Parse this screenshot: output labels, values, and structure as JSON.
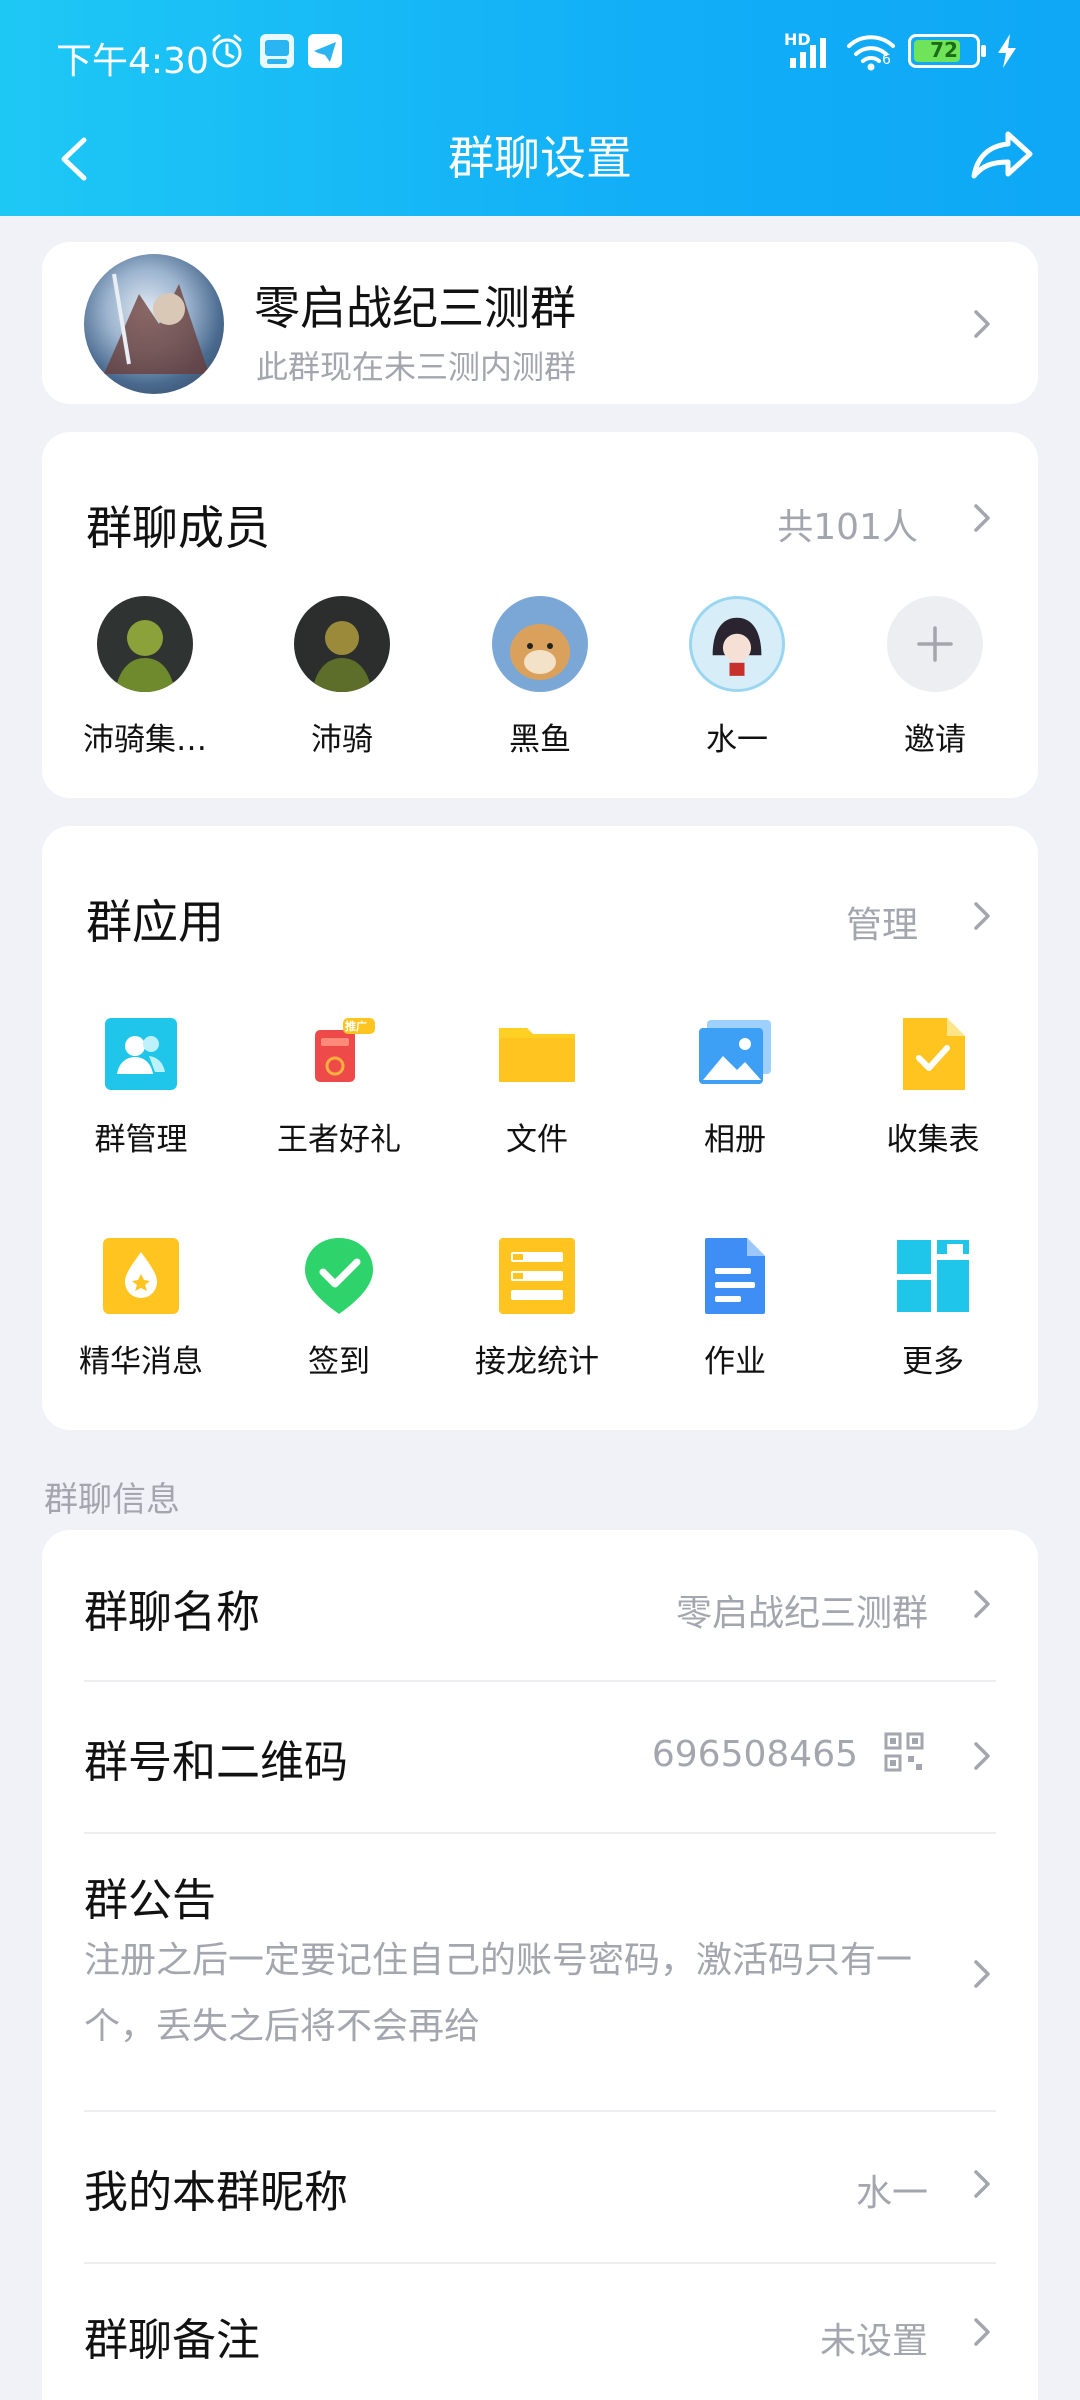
{
  "status_bar": {
    "time": "下午4:30",
    "hd_label": "HD",
    "battery": "72",
    "net_sub": "6"
  },
  "nav": {
    "title": "群聊设置"
  },
  "group": {
    "name": "零启战纪三测群",
    "subtitle": "此群现在未三测内测群"
  },
  "members": {
    "title": "群聊成员",
    "count_label": "共101人",
    "items": [
      {
        "name": "沛骑集…"
      },
      {
        "name": "沛骑"
      },
      {
        "name": "黑鱼"
      },
      {
        "name": "水一"
      },
      {
        "name": "邀请"
      }
    ]
  },
  "apps": {
    "title": "群应用",
    "manage_label": "管理",
    "items": [
      {
        "label": "群管理",
        "icon": "group-manage-icon",
        "color": "#1fc6ea"
      },
      {
        "label": "王者好礼",
        "icon": "gift-icon",
        "color": "#ef4a4a"
      },
      {
        "label": "文件",
        "icon": "folder-icon",
        "color": "#ffc41f"
      },
      {
        "label": "相册",
        "icon": "album-icon",
        "color": "#3ea0f5"
      },
      {
        "label": "收集表",
        "icon": "collect-form-icon",
        "color": "#ffc41f"
      },
      {
        "label": "精华消息",
        "icon": "essence-icon",
        "color": "#ffc41f"
      },
      {
        "label": "签到",
        "icon": "checkin-icon",
        "color": "#2ed36b"
      },
      {
        "label": "接龙统计",
        "icon": "solitaire-icon",
        "color": "#ffc41f"
      },
      {
        "label": "作业",
        "icon": "homework-icon",
        "color": "#3e8ef5"
      },
      {
        "label": "更多",
        "icon": "more-grid-icon",
        "color": "#1fc6ea"
      }
    ],
    "gift_badge": "推广"
  },
  "info": {
    "section_label": "群聊信息",
    "name_label": "群聊名称",
    "name_value": "零启战纪三测群",
    "id_label": "群号和二维码",
    "id_value": "696508465",
    "notice_label": "群公告",
    "notice_text": "注册之后一定要记住自己的账号密码，激活码只有一个，丢失之后将不会再给",
    "nickname_label": "我的本群昵称",
    "nickname_value": "水一",
    "remark_label": "群聊备注",
    "remark_value": "未设置"
  }
}
